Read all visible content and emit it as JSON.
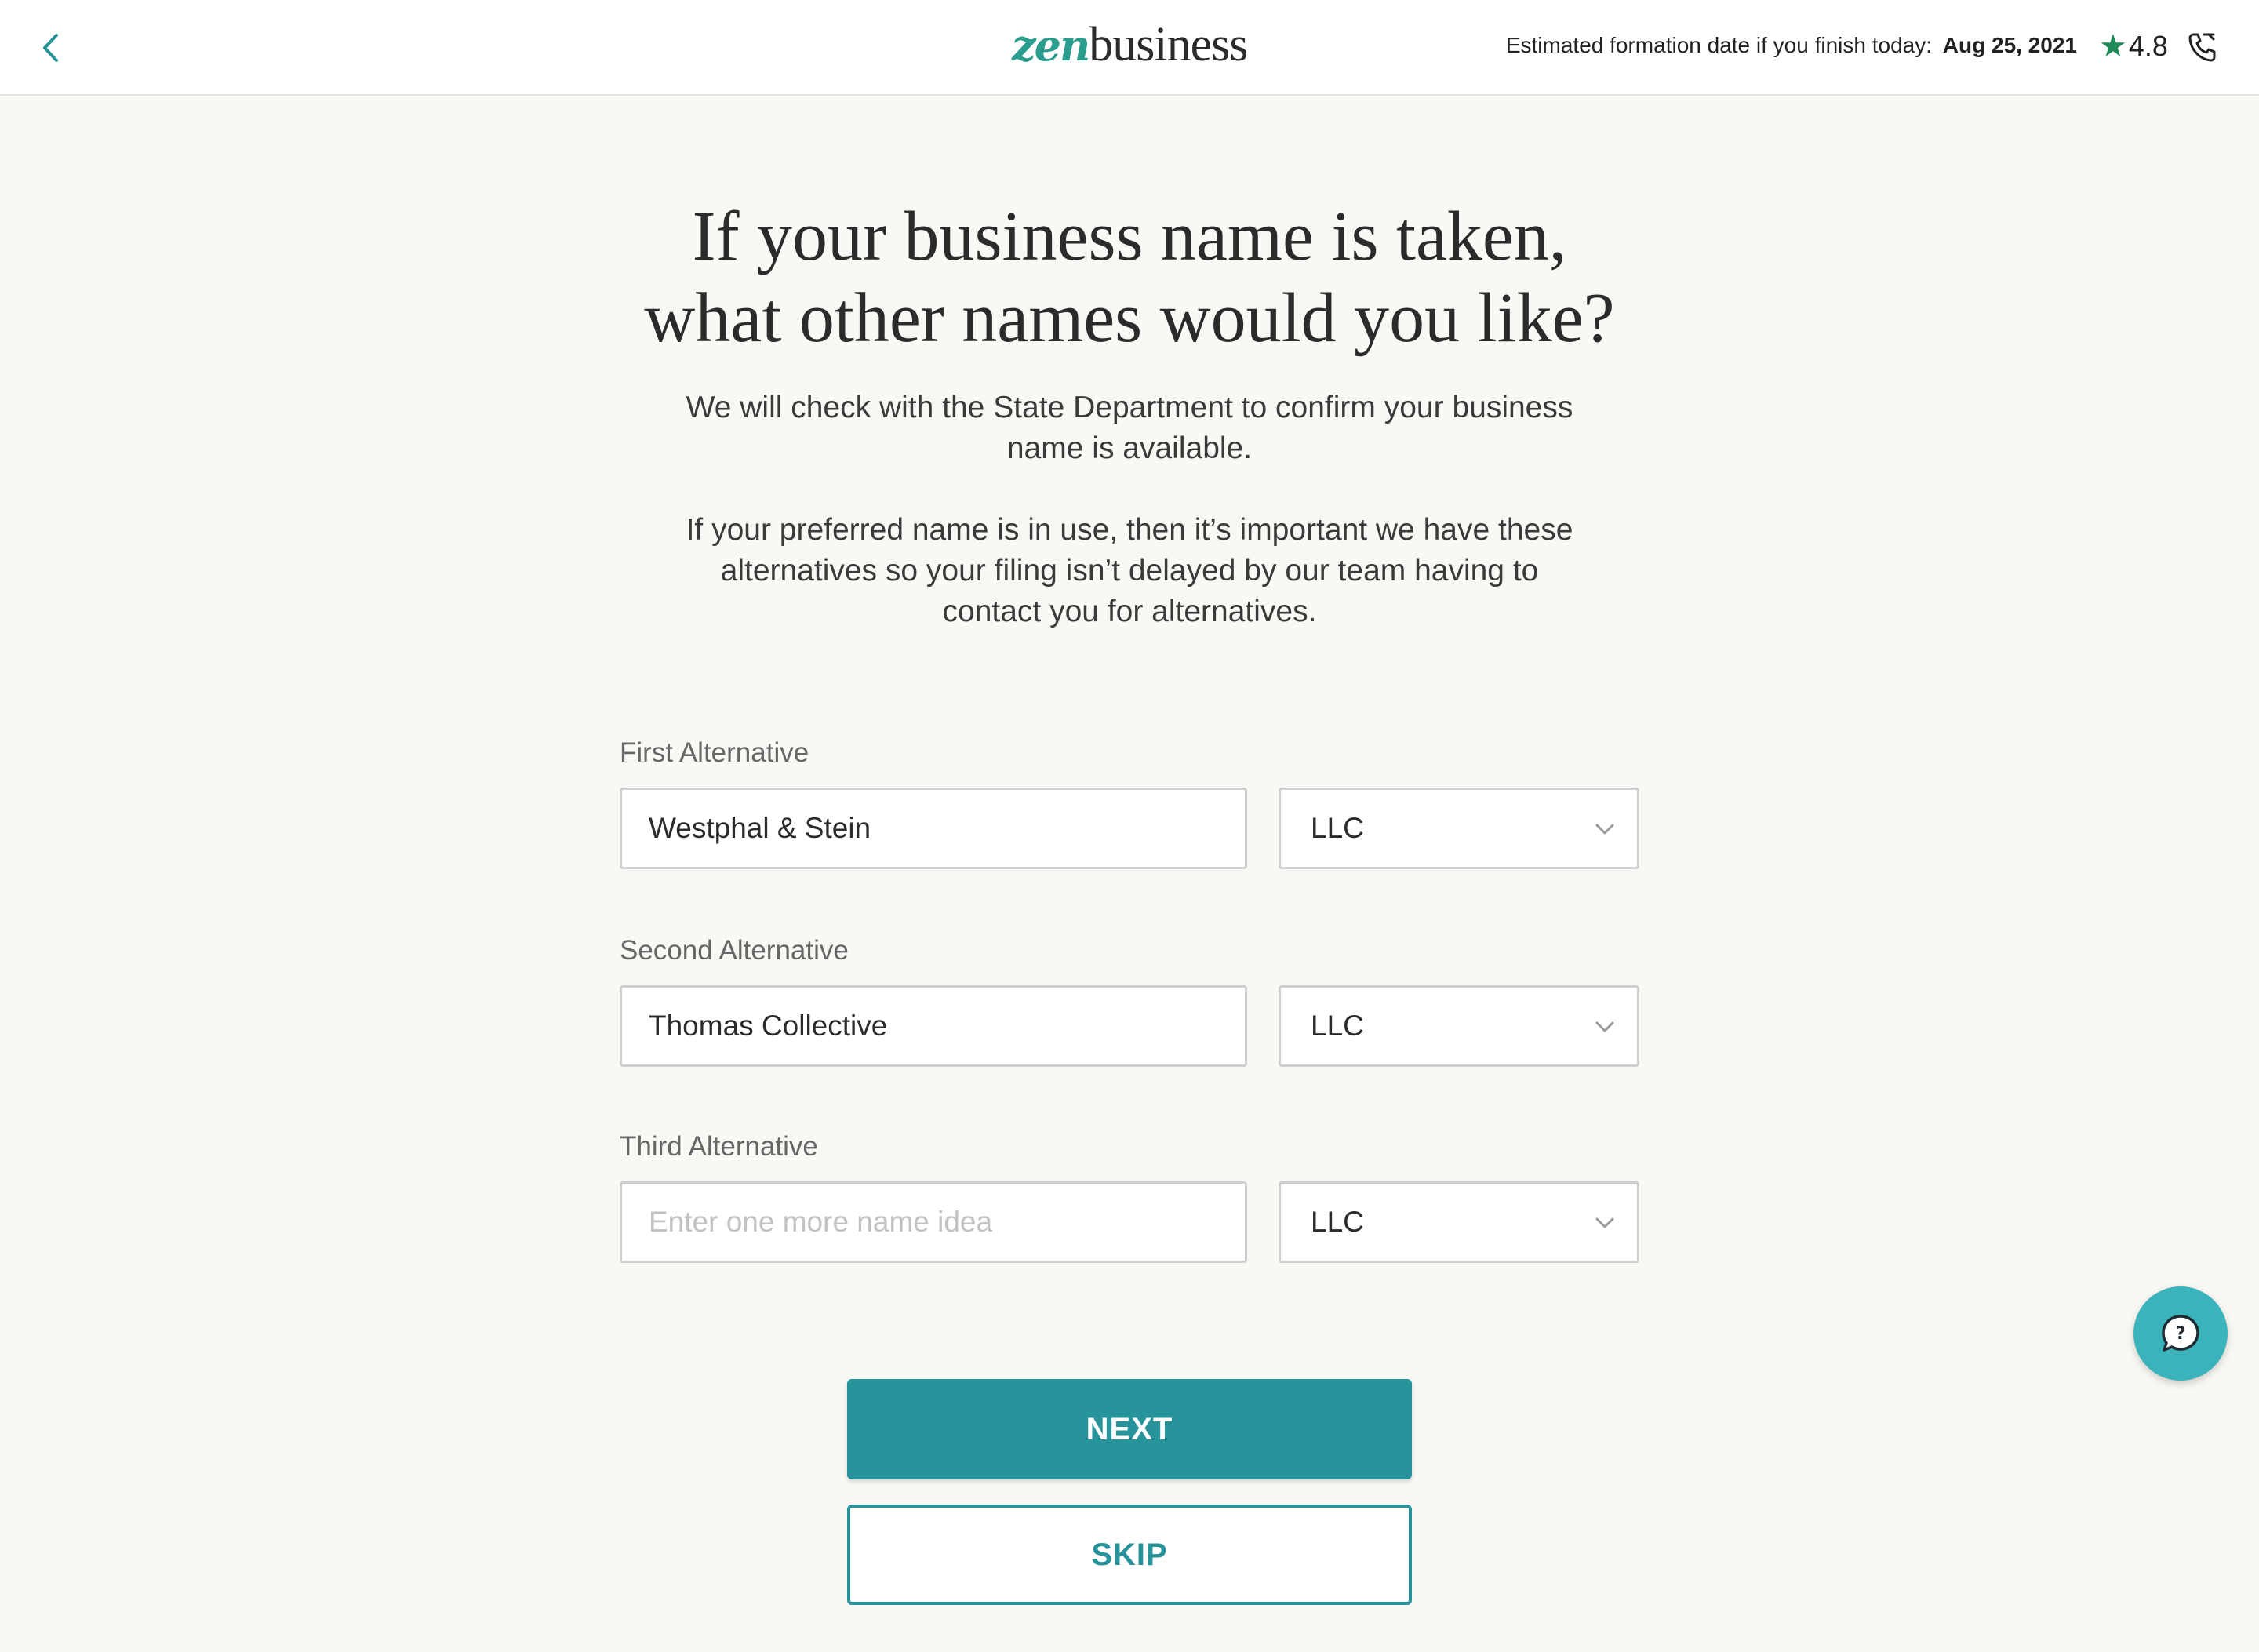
{
  "header": {
    "logo_zen": "zen",
    "logo_business": "business",
    "estimate_label": "Estimated formation date if you finish today:",
    "estimate_date": "Aug 25, 2021",
    "rating": "4.8",
    "icons": {
      "back": "chevron-left-icon",
      "rating": "star-icon",
      "phone": "phone-icon"
    }
  },
  "main": {
    "headline_line1": "If your business name is taken,",
    "headline_line2": "what other names would you like?",
    "paragraph1_line1": "We will check with the State Department to confirm your business",
    "paragraph1_line2": "name is available.",
    "paragraph2_line1": "If your preferred name is in use, then it’s important we have these",
    "paragraph2_line2": "alternatives so your filing isn’t delayed by our team having to",
    "paragraph2_line3": "contact you for alternatives."
  },
  "form": {
    "first": {
      "label": "First Alternative",
      "value": "Westphal & Stein",
      "placeholder": "",
      "entity": "LLC"
    },
    "second": {
      "label": "Second Alternative",
      "value": "Thomas Collective",
      "placeholder": "",
      "entity": "LLC"
    },
    "third": {
      "label": "Third Alternative",
      "value": "",
      "placeholder": "Enter one more name idea",
      "entity": "LLC"
    }
  },
  "actions": {
    "next_label": "NEXT",
    "skip_label": "SKIP"
  },
  "colors": {
    "accent": "#27939b",
    "logo_accent": "#2a9d8f",
    "star": "#1f8a5a",
    "help_button": "#3bb3bb",
    "background": "#f9f8f5"
  }
}
